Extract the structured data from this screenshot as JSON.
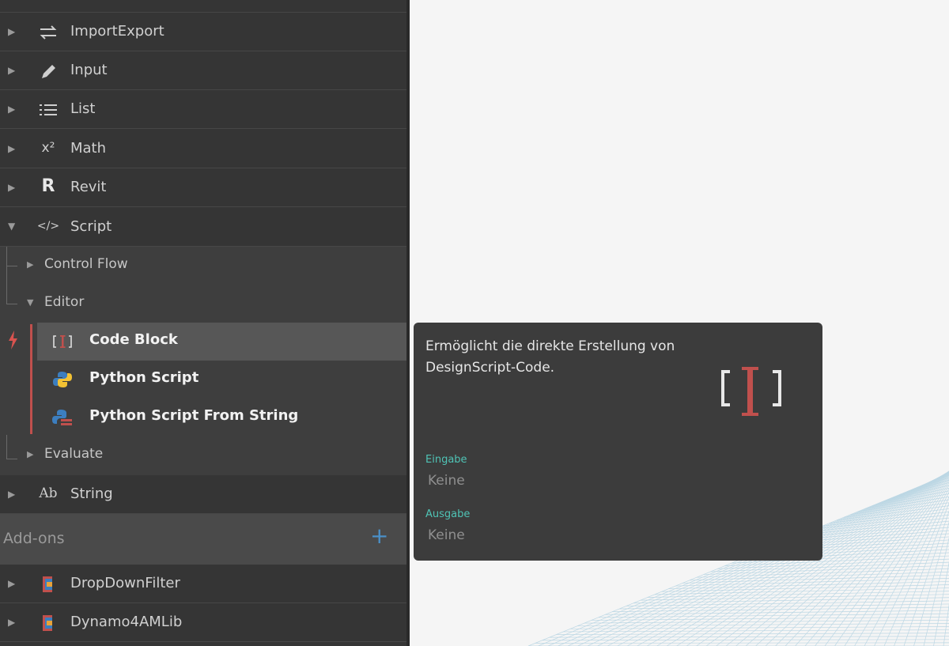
{
  "library": {
    "categories": [
      {
        "label": "ImportExport",
        "icon": "import-export-icon"
      },
      {
        "label": "Input",
        "icon": "pencil-icon"
      },
      {
        "label": "List",
        "icon": "list-icon"
      },
      {
        "label": "Math",
        "icon": "math-icon"
      },
      {
        "label": "Revit",
        "icon": "revit-icon"
      },
      {
        "label": "Script",
        "icon": "script-icon"
      }
    ],
    "script_sub": {
      "control_flow": "Control Flow",
      "editor": "Editor",
      "evaluate": "Evaluate"
    },
    "editor_nodes": [
      {
        "label": "Code Block",
        "icon": "code-block-icon"
      },
      {
        "label": "Python Script",
        "icon": "python-icon"
      },
      {
        "label": "Python Script From String",
        "icon": "python-string-icon"
      }
    ],
    "string_category": {
      "label": "String",
      "icon": "string-icon"
    },
    "addons": {
      "label": "Add-ons",
      "plus": "+"
    },
    "addon_items": [
      {
        "label": "DropDownFilter",
        "icon": "package-icon"
      },
      {
        "label": "Dynamo4AMLib",
        "icon": "package-icon"
      }
    ],
    "icons": {
      "math": "x²",
      "string": "Ab",
      "script": "</>",
      "revit": "R",
      "code": "[I]"
    }
  },
  "tooltip": {
    "description": "Ermöglicht die direkte Erstellung von DesignScript-Code.",
    "input_heading": "Eingabe",
    "input_value": "Keine",
    "output_heading": "Ausgabe",
    "output_value": "Keine"
  },
  "colors": {
    "accent_red": "#c0504d",
    "teal": "#4fc3b5",
    "plus_blue": "#4a90c8"
  }
}
